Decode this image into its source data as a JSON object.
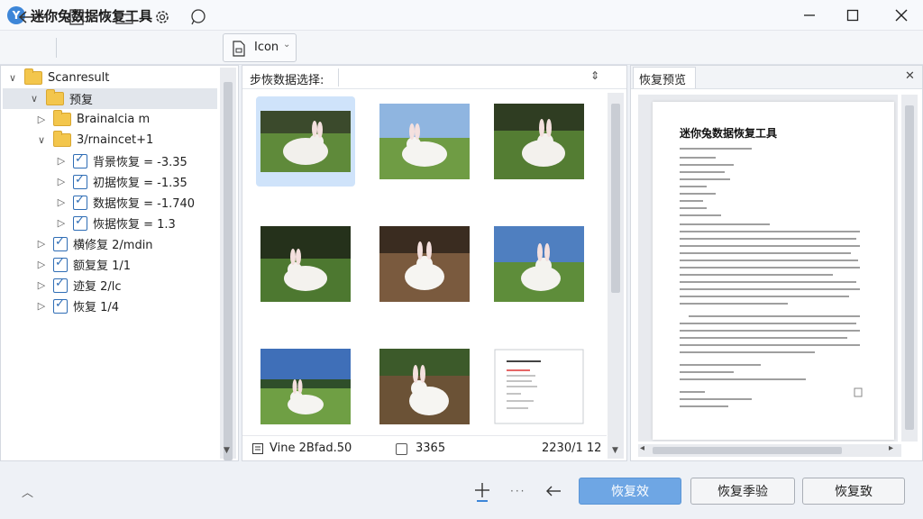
{
  "app": {
    "title": "迷你兔数据恢复工具",
    "logo": "Y"
  },
  "toolbar": {
    "view_label": "Icon"
  },
  "tree": {
    "items": [
      {
        "label": "Scanresult",
        "expander": "∨",
        "level": 0,
        "type": "folder"
      },
      {
        "label": "预复",
        "expander": "∨",
        "level": 1,
        "type": "folder",
        "selected": true
      },
      {
        "label": "Brainalcia m",
        "expander": "▷",
        "level": 2,
        "type": "folder"
      },
      {
        "label": "3/rnaincet+1",
        "expander": "∨",
        "level": 2,
        "type": "folder"
      },
      {
        "label": "背景恢复 = -3.35",
        "expander": "▷",
        "level": 3,
        "type": "check"
      },
      {
        "label": "初据恢复 = -1.35",
        "expander": "▷",
        "level": 3,
        "type": "check"
      },
      {
        "label": "数据恢复 = -1.740",
        "expander": "▷",
        "level": 3,
        "type": "check"
      },
      {
        "label": "恢据恢复 = 1.3",
        "expander": "▷",
        "level": 3,
        "type": "check"
      },
      {
        "label": "横修复 2/mdin",
        "expander": "▷",
        "level": 2,
        "type": "check"
      },
      {
        "label": "额复复 1/1",
        "expander": "▷",
        "level": 2,
        "type": "check"
      },
      {
        "label": "迹复 2/lc",
        "expander": "▷",
        "level": 2,
        "type": "check"
      },
      {
        "label": "恢复 1/4",
        "expander": "▷",
        "level": 2,
        "type": "check"
      }
    ]
  },
  "grid": {
    "filter_label": "步恢数据选择:",
    "status_left": "Vine 2Bfad.50",
    "status_mid": "3365",
    "status_right": "2230/1 12"
  },
  "preview": {
    "tab_label": "恢复预览",
    "doc_title": "迷你兔数据恢复工具"
  },
  "actions": {
    "primary": "恢复效",
    "secondary": "恢复季验",
    "tertiary": "恢复致"
  },
  "colors": {
    "accent": "#6ea6e4",
    "selected": "#cfe3fa",
    "tree_selected": "#e2e6ec"
  },
  "icons": [
    "back-arrow-icon",
    "document-icon",
    "folder-icon",
    "gear-icon",
    "chat-bubble-icon",
    "view-file-icon",
    "minimize-icon",
    "maximize-icon",
    "close-icon"
  ]
}
